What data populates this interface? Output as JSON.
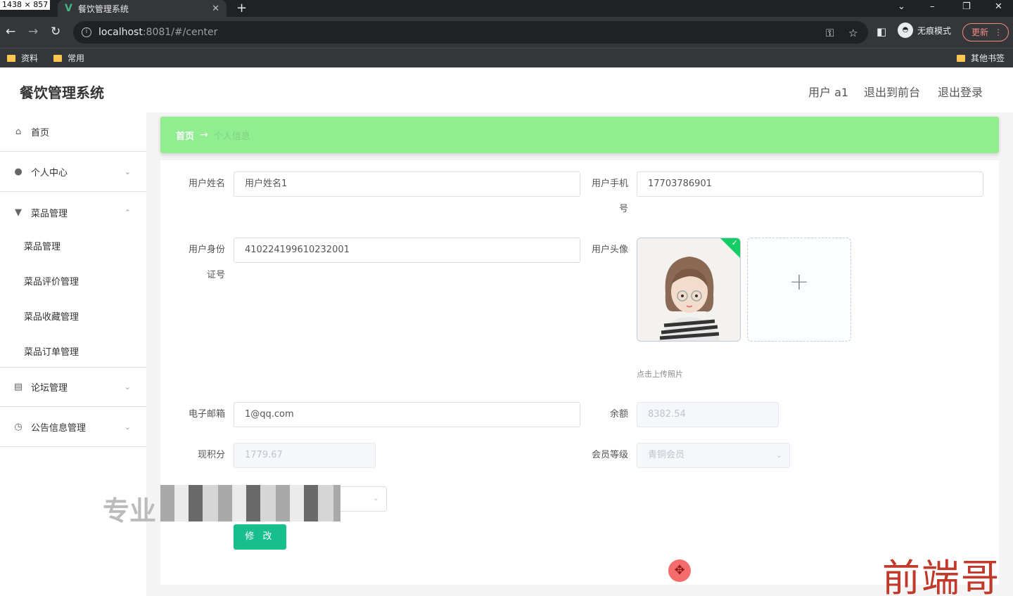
{
  "browser": {
    "dimensions_badge": "1438 × 857",
    "tab_title": "餐饮管理系统",
    "url_host": "localhost",
    "url_rest": ":8081/#/center",
    "incognito_label": "无痕模式",
    "update_label": "更新",
    "bookmarks": [
      "资料",
      "常用"
    ],
    "other_bookmarks": "其他书签"
  },
  "header": {
    "title": "餐饮管理系统",
    "user": "用户 a1",
    "to_front": "退出到前台",
    "logout": "退出登录"
  },
  "sidebar": {
    "items": [
      {
        "label": "首页",
        "icon": "home-icon"
      },
      {
        "label": "个人中心",
        "icon": "user-icon"
      },
      {
        "label": "菜品管理",
        "icon": "dish-icon"
      },
      {
        "label": "论坛管理",
        "icon": "forum-icon"
      },
      {
        "label": "公告信息管理",
        "icon": "clock-icon"
      }
    ],
    "dish_submenu": [
      "菜品管理",
      "菜品评价管理",
      "菜品收藏管理",
      "菜品订单管理"
    ]
  },
  "breadcrumb": {
    "home": "首页",
    "arrow": "→",
    "current": "个人信息"
  },
  "form": {
    "username_label": "用户姓名",
    "username_value": "用户姓名1",
    "phone_label_1": "用户手机",
    "phone_label_2": "号",
    "phone_value": "17703786901",
    "idcard_label_1": "用户身份",
    "idcard_label_2": "证号",
    "idcard_value": "410224199610232001",
    "avatar_label": "用户头像",
    "upload_tip": "点击上传照片",
    "email_label": "电子邮箱",
    "email_value": "1@qq.com",
    "balance_label": "余额",
    "balance_value": "8382.54",
    "points_label": "现积分",
    "points_value": "1779.67",
    "level_label": "会员等级",
    "level_value": "青铜会员",
    "submit_label": "修 改"
  },
  "watermarks": {
    "left": "专业",
    "right": "前端哥"
  }
}
